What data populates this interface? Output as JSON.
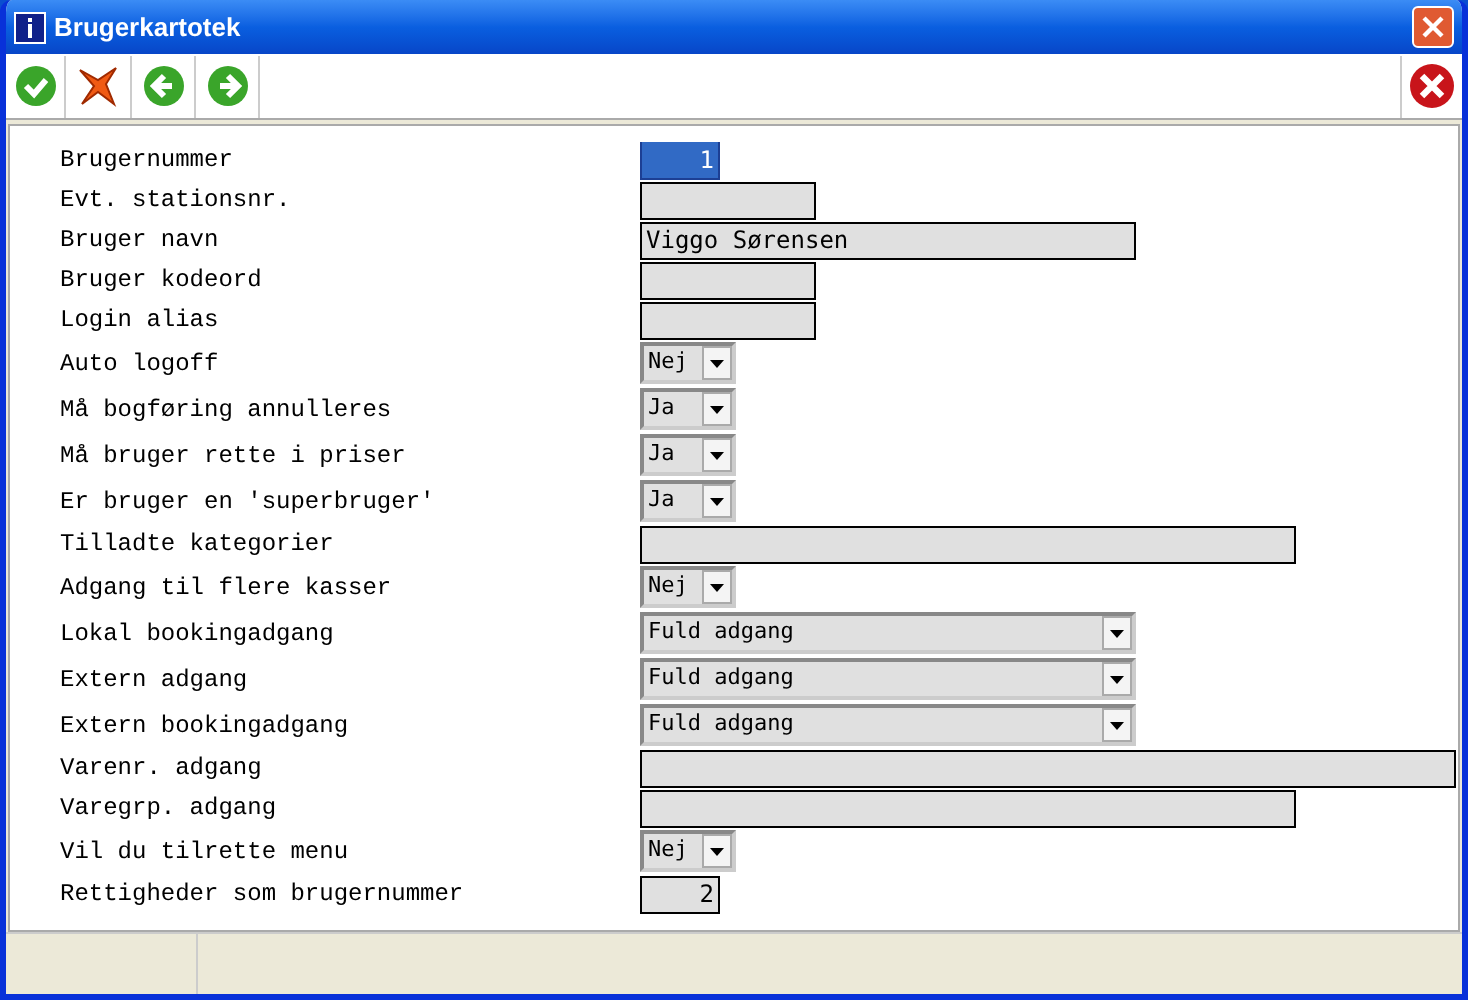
{
  "window": {
    "title": "Brugerkartotek"
  },
  "fields": [
    {
      "label": "Brugernummer",
      "kind": "number",
      "value": "1",
      "focused": true
    },
    {
      "label": "Evt. stationsnr.",
      "kind": "text",
      "focused": false
    },
    {
      "label": "Bruger navn",
      "kind": "text",
      "value": "Viggo Sørensen",
      "focused": false
    },
    {
      "label": "Bruger kodeord",
      "kind": "text",
      "focused": false
    },
    {
      "label": "Login alias",
      "kind": "text",
      "focused": false
    },
    {
      "label": "Auto logoff",
      "kind": "select",
      "value": "Nej",
      "focused": false
    },
    {
      "label": "Må bogføring annulleres",
      "kind": "select",
      "value": "Ja",
      "focused": false
    },
    {
      "label": "Må bruger rette i priser",
      "kind": "select",
      "value": "Ja",
      "focused": false
    },
    {
      "label": "Er bruger en 'superbruger'",
      "kind": "select",
      "value": "Ja",
      "focused": false
    },
    {
      "label": "Tilladte kategorier",
      "kind": "text",
      "focused": false
    },
    {
      "label": "Adgang til flere kasser",
      "kind": "select",
      "value": "Nej",
      "focused": false
    },
    {
      "label": "Lokal bookingadgang",
      "kind": "select",
      "value": "Fuld adgang",
      "focused": false
    },
    {
      "label": "Extern adgang",
      "kind": "select",
      "value": "Fuld adgang",
      "focused": false
    },
    {
      "label": "Extern bookingadgang",
      "kind": "select",
      "value": "Fuld adgang",
      "focused": false
    },
    {
      "label": "Varenr. adgang",
      "kind": "text",
      "focused": false
    },
    {
      "label": "Varegrp. adgang",
      "kind": "text",
      "focused": false
    },
    {
      "label": "Vil du tilrette menu",
      "kind": "select",
      "value": "Nej",
      "focused": false
    },
    {
      "label": "Rettigheder som brugernummer",
      "kind": "number",
      "value": "2",
      "focused": false
    }
  ]
}
